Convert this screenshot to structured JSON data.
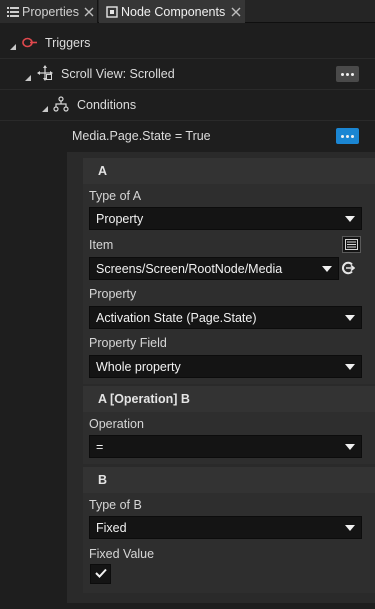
{
  "tabs": [
    {
      "label": "Properties",
      "icon": "list-icon",
      "active": false
    },
    {
      "label": "Node Components",
      "icon": "node-components-icon",
      "active": true
    }
  ],
  "tree": {
    "triggers": {
      "label": "Triggers",
      "icon": "trigger-icon"
    },
    "scroll_view": {
      "label": "Scroll View: Scrolled",
      "icon": "scroll-move-icon"
    },
    "conditions": {
      "label": "Conditions",
      "icon": "conditions-tree-icon"
    },
    "condition": {
      "label": "Media.Page.State = True"
    }
  },
  "section_a": {
    "header": "A",
    "type_label": "Type of A",
    "type_value": "Property",
    "item_label": "Item",
    "item_value": "Screens/Screen/RootNode/Media",
    "property_label": "Property",
    "property_value": "Activation State (Page.State)",
    "property_field_label": "Property Field",
    "property_field_value": "Whole property"
  },
  "section_op": {
    "header": "A [Operation] B",
    "operation_label": "Operation",
    "operation_value": "="
  },
  "section_b": {
    "header": "B",
    "type_label": "Type of B",
    "type_value": "Fixed",
    "fixed_label": "Fixed Value",
    "fixed_checked": true
  },
  "colors": {
    "accent": "#1b86d3",
    "trigger_icon": "#e0484d",
    "background": "#1e1e1e"
  }
}
